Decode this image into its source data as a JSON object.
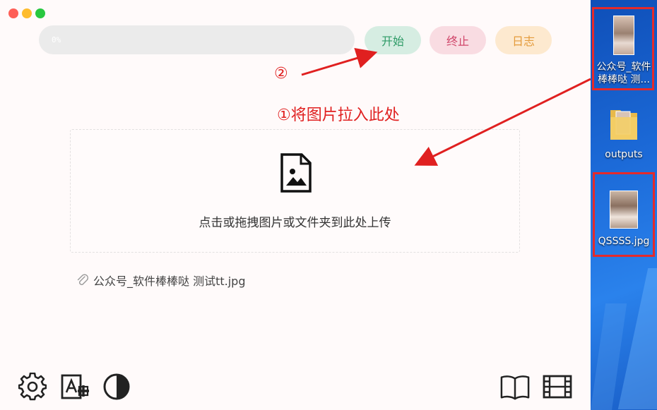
{
  "toolbar": {
    "progress_text": "0%",
    "start_label": "开始",
    "stop_label": "终止",
    "log_label": "日志"
  },
  "annotations": {
    "step2": "②",
    "step1": "①将图片拉入此处"
  },
  "dropzone": {
    "hint": "点击或拖拽图片或文件夹到此处上传"
  },
  "file": {
    "name": "公众号_软件棒棒哒 测试tt.jpg"
  },
  "bottom_icons": [
    "gear-icon",
    "font-icon",
    "contrast-icon",
    "book-icon",
    "film-icon"
  ],
  "desktop": {
    "icons": [
      {
        "label_line1": "公众号_软件",
        "label_line2": "棒棒哒 测..."
      },
      {
        "label": "outputs"
      },
      {
        "label": "QSSSS.jpg"
      }
    ]
  },
  "colors": {
    "accent_green": "#2f9b67",
    "accent_red": "#d0466a",
    "accent_orange": "#e49b3b",
    "annotation_red": "#e02020"
  }
}
